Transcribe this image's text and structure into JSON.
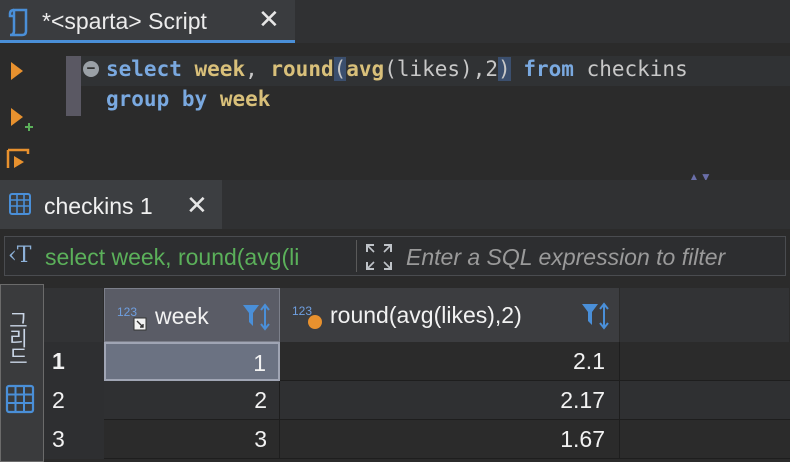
{
  "editor_tab": {
    "title": "*<sparta> Script",
    "close": "✕"
  },
  "editor": {
    "fold_symbol": "−",
    "line1": {
      "kw1": "select",
      "sp1": " ",
      "fn1": "week",
      "c1": ", ",
      "fn2": "round",
      "p1": "(",
      "fn3": "avg",
      "p2": "(likes),",
      "n1": "2",
      "p3": ")",
      "sp2": " ",
      "kw2": "from",
      "sp3": " ",
      "tbl": "checkins"
    },
    "line2": {
      "kw1": "group by",
      "sp": " ",
      "col": "week"
    },
    "scroll_marks": "▲▼"
  },
  "results_tab": {
    "title": "checkins 1",
    "close": "✕"
  },
  "filter": {
    "sql_icon": "‹T",
    "query_text": "select week, round(avg(li",
    "placeholder": "Enter a SQL expression to filter"
  },
  "side_panel": {
    "label": "그리드"
  },
  "grid": {
    "columns": [
      {
        "badge": "123",
        "label": "week"
      },
      {
        "badge": "123",
        "label": "round(avg(likes),2)"
      }
    ],
    "rows": [
      {
        "num": "1",
        "week": "1",
        "round": "2.1"
      },
      {
        "num": "2",
        "week": "2",
        "round": "2.17"
      },
      {
        "num": "3",
        "week": "3",
        "round": "1.67"
      }
    ]
  },
  "colors": {
    "accent": "#4a8fd8",
    "run_orange": "#e8912e",
    "keyword": "#7aa9e0",
    "function": "#d9c07a",
    "filter_text": "#5bb05a"
  },
  "icons": [
    "script-icon",
    "execute-statement-icon",
    "execute-new-tab-icon",
    "execute-script-icon",
    "grid-icon",
    "expand-icon",
    "filter-sort-icon"
  ]
}
